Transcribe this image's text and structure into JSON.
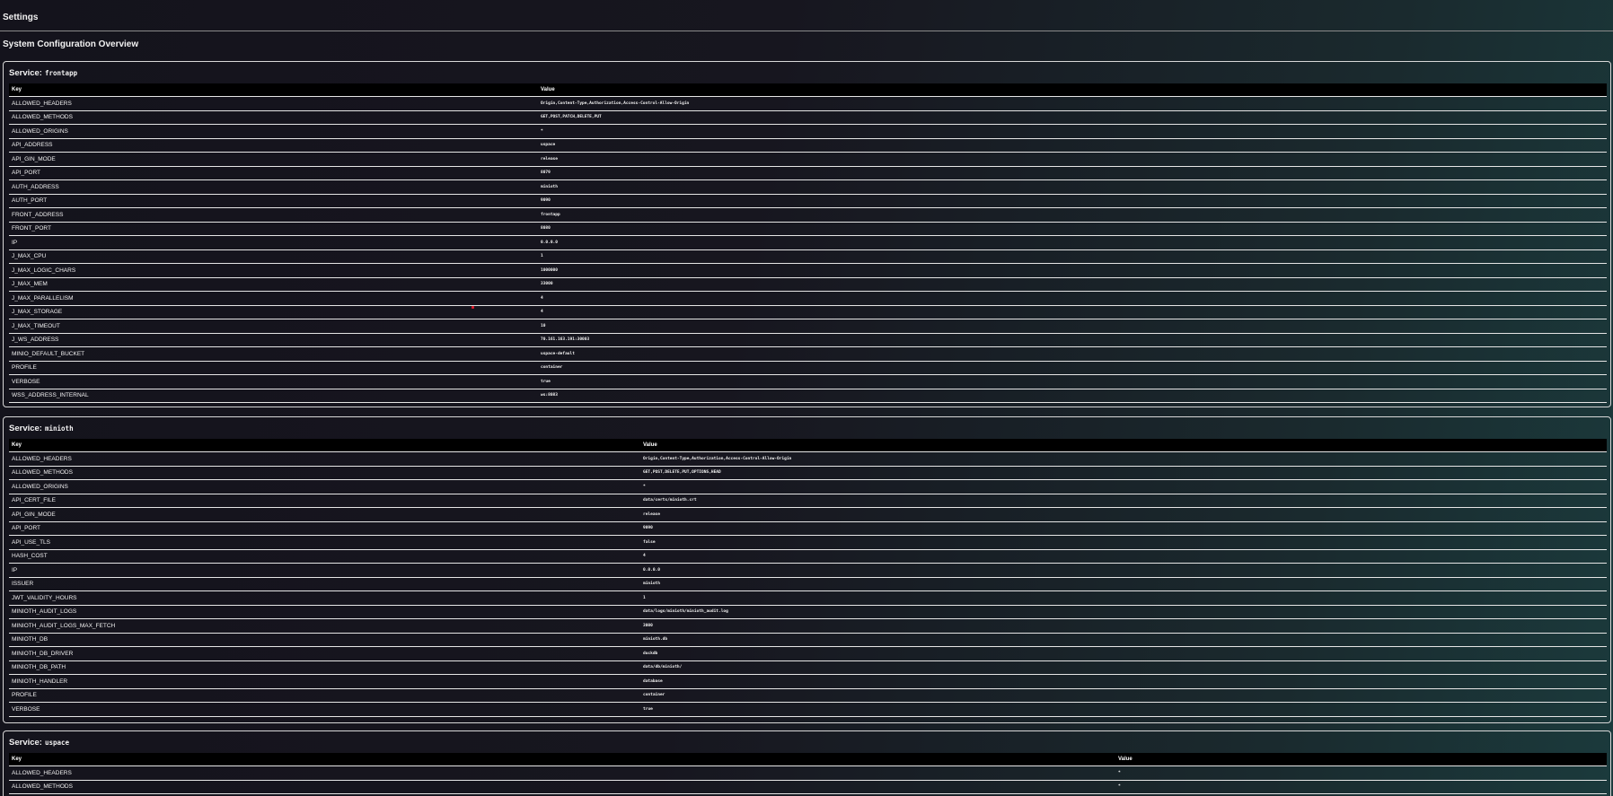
{
  "page": {
    "title": "Settings",
    "section_title": "System Configuration Overview",
    "service_prefix": "Service:",
    "columns": {
      "key": "Key",
      "value": "Value"
    }
  },
  "services": [
    {
      "name": "frontapp",
      "rows": [
        [
          "ALLOWED_HEADERS",
          "Origin,Content-Type,Authorization,Access-Control-Allow-Origin"
        ],
        [
          "ALLOWED_METHODS",
          "GET,POST,PATCH,DELETE,PUT"
        ],
        [
          "ALLOWED_ORIGINS",
          "*"
        ],
        [
          "API_ADDRESS",
          "uspace"
        ],
        [
          "API_GIN_MODE",
          "release"
        ],
        [
          "API_PORT",
          "8079"
        ],
        [
          "AUTH_ADDRESS",
          "minioth"
        ],
        [
          "AUTH_PORT",
          "9090"
        ],
        [
          "FRONT_ADDRESS",
          "frontapp"
        ],
        [
          "FRONT_PORT",
          "8080"
        ],
        [
          "IP",
          "0.0.0.0"
        ],
        [
          "J_MAX_CPU",
          "1"
        ],
        [
          "J_MAX_LOGIC_CHARS",
          "1000000"
        ],
        [
          "J_MAX_MEM",
          "33000"
        ],
        [
          "J_MAX_PARALLELISM",
          "4"
        ],
        [
          "J_MAX_STORAGE",
          "4"
        ],
        [
          "J_MAX_TIMEOUT",
          "10"
        ],
        [
          "J_WS_ADDRESS",
          "70.161.163.191:30003"
        ],
        [
          "MINIO_DEFAULT_BUCKET",
          "uspace-default"
        ],
        [
          "PROFILE",
          "container"
        ],
        [
          "VERBOSE",
          "true"
        ],
        [
          "WSS_ADDRESS_INTERNAL",
          "ws:8083"
        ]
      ]
    },
    {
      "name": "minioth",
      "rows": [
        [
          "ALLOWED_HEADERS",
          "Origin,Content-Type,Authorization,Access-Control-Allow-Origin"
        ],
        [
          "ALLOWED_METHODS",
          "GET,POST,DELETE,PUT,OPTIONS,HEAD"
        ],
        [
          "ALLOWED_ORIGINS",
          "*"
        ],
        [
          "API_CERT_FILE",
          "data/certs/minioth.crt"
        ],
        [
          "API_GIN_MODE",
          "release"
        ],
        [
          "API_PORT",
          "9090"
        ],
        [
          "API_USE_TLS",
          "false"
        ],
        [
          "HASH_COST",
          "4"
        ],
        [
          "IP",
          "0.0.0.0"
        ],
        [
          "ISSUER",
          "minioth"
        ],
        [
          "JWT_VALIDITY_HOURS",
          "1"
        ],
        [
          "MINIOTH_AUDIT_LOGS",
          "data/logs/minioth/minioth_audit.log"
        ],
        [
          "MINIOTH_AUDIT_LOGS_MAX_FETCH",
          "3000"
        ],
        [
          "MINIOTH_DB",
          "minioth.db"
        ],
        [
          "MINIOTH_DB_DRIVER",
          "duckdb"
        ],
        [
          "MINIOTH_DB_PATH",
          "data/db/minioth/"
        ],
        [
          "MINIOTH_HANDLER",
          "database"
        ],
        [
          "PROFILE",
          "container"
        ],
        [
          "VERBOSE",
          "true"
        ]
      ]
    },
    {
      "name": "uspace",
      "rows": [
        [
          "ALLOWED_HEADERS",
          "*"
        ],
        [
          "ALLOWED_METHODS",
          "*"
        ]
      ]
    }
  ]
}
